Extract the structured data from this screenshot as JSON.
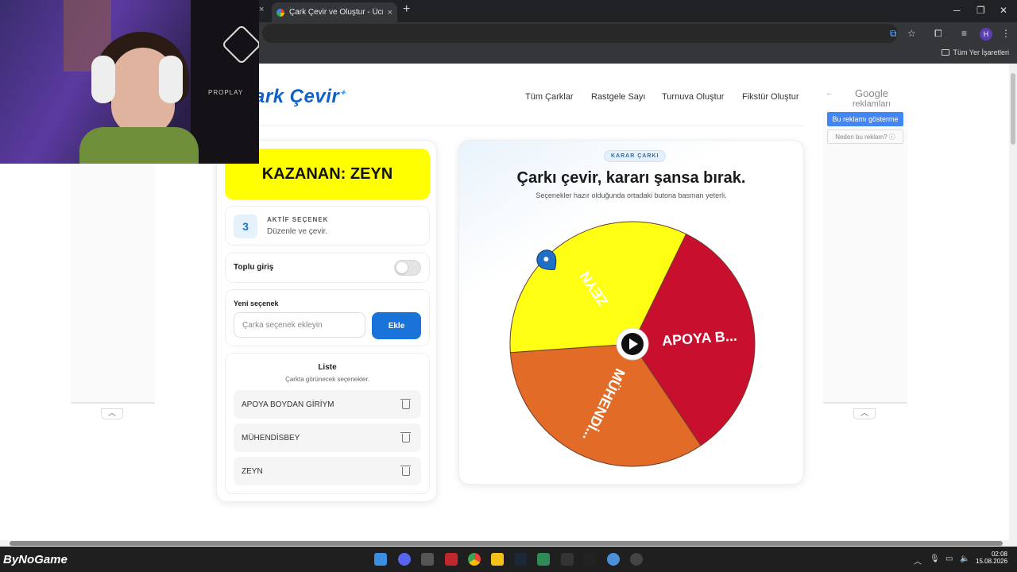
{
  "browser": {
    "tab_title": "Çark Çevir ve Oluştur - Ücretsiz",
    "tab_close": "×",
    "new_tab": "+",
    "bookmarks_all": "Tüm Yer İşaretleri",
    "profile_initial": "H"
  },
  "site": {
    "logo": "ark Çevir",
    "nav": [
      "Tüm Çarklar",
      "Rastgele Sayı",
      "Turnuva Oluştur",
      "Fikstür Oluştur"
    ]
  },
  "ad": {
    "brand": "Google",
    "subtitle": "reklamları",
    "hide_button": "Bu reklamı gösterme",
    "why_button": "Neden bu reklam? ⓘ"
  },
  "left_panel": {
    "winner": "KAZANAN: ZEYN",
    "active_count": "3",
    "active_title": "AKTİF SEÇENEK",
    "active_sub": "Düzenle ve çevir.",
    "bulk_label": "Toplu giriş",
    "bulk_enabled": false,
    "new_label": "Yeni seçenek",
    "new_placeholder": "Çarka seçenek ekleyin",
    "add_button": "Ekle",
    "list_title": "Liste",
    "list_sub": "Çarkta görünecek seçenekler.",
    "items": [
      "APOYA BOYDAN GİRİYM",
      "MÜHENDİSBEY",
      "ZEYN"
    ]
  },
  "wheel_panel": {
    "badge": "KARAR ÇARKI",
    "title": "Çarkı çevir, kararı şansa bırak.",
    "subtitle": "Seçenekler hazır olduğunda ortadaki butona basman yeterli.",
    "segments": [
      {
        "label": "APOYA B...",
        "color": "#c8102e"
      },
      {
        "label": "MÜHENDİ...",
        "color": "#e26b27"
      },
      {
        "label": "ZEYN",
        "color": "#ffff14"
      }
    ]
  },
  "webcam": {
    "brand": "PROPLAY"
  },
  "taskbar": {
    "brand": "ByNoGame",
    "time": "02:08",
    "date": "15.08.2026"
  }
}
